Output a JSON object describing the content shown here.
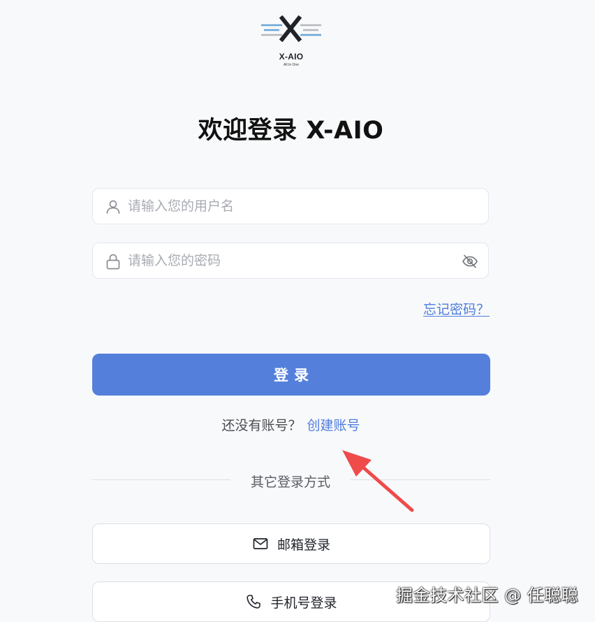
{
  "logo": {
    "name": "X-AIO",
    "tagline": "All In One"
  },
  "title": "欢迎登录 X-AIO",
  "form": {
    "username_placeholder": "请输入您的用户名",
    "password_placeholder": "请输入您的密码",
    "username_value": "",
    "password_value": "",
    "forgot_label": "忘记密码？",
    "login_label": "登录"
  },
  "register": {
    "prompt": "还没有账号？",
    "link": "创建账号"
  },
  "divider": {
    "label": "其它登录方式"
  },
  "alt_logins": {
    "email_label": "邮箱登录",
    "phone_label": "手机号登录"
  },
  "watermark": "掘金技术社区 @ 任聪聪",
  "colors": {
    "primary": "#5480dc",
    "link": "#4f7ddc",
    "arrow": "#ef4b4b",
    "background": "#f8f9fb"
  },
  "icons": {
    "username": "user-icon",
    "password": "lock-icon",
    "visibility": "eye-off-icon",
    "email": "mail-icon",
    "phone": "phone-icon"
  }
}
